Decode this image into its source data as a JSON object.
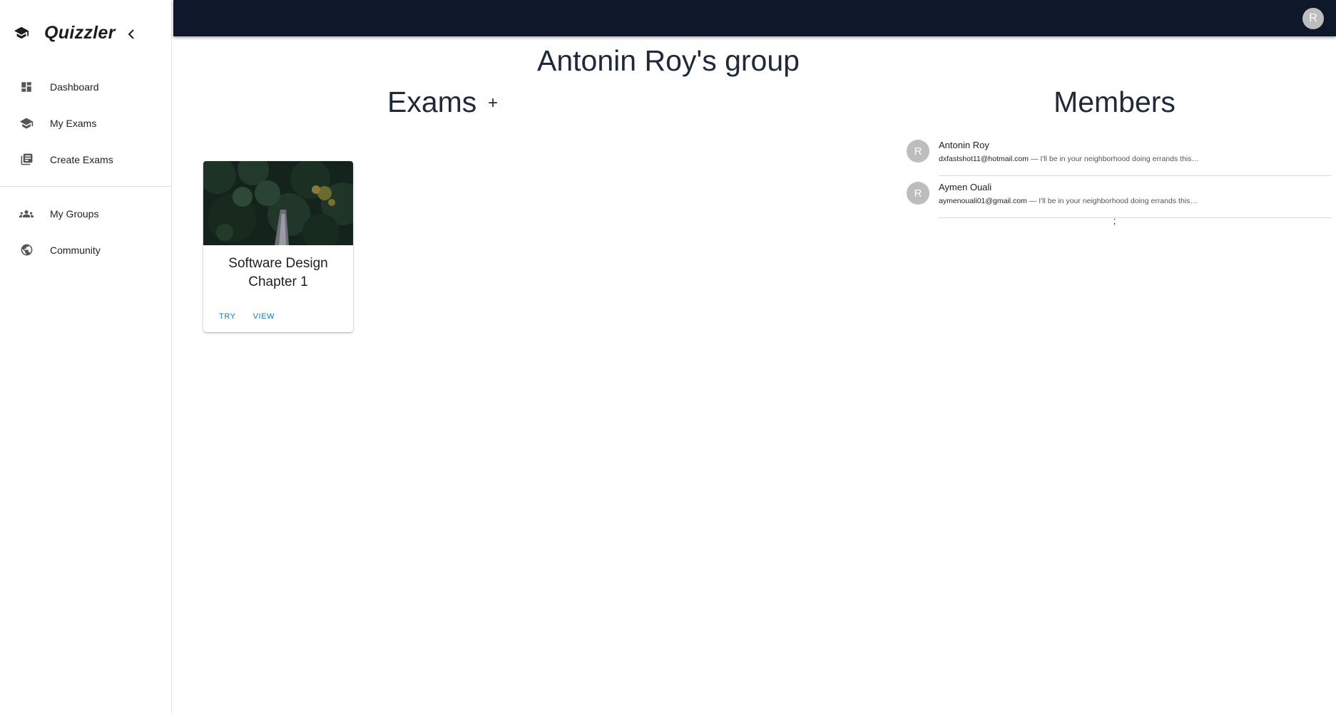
{
  "app": {
    "name": "Quizzler",
    "user_initial": "R"
  },
  "sidebar": {
    "items": [
      {
        "label": "Dashboard",
        "icon": "dashboard-icon"
      },
      {
        "label": "My Exams",
        "icon": "graduation-cap-icon"
      },
      {
        "label": "Create Exams",
        "icon": "library-books-icon"
      },
      {
        "label": "My Groups",
        "icon": "groups-icon"
      },
      {
        "label": "Community",
        "icon": "globe-icon"
      }
    ]
  },
  "page": {
    "title": "Antonin Roy's group",
    "exams_heading": "Exams",
    "add_exam_symbol": "+",
    "members_heading": "Members"
  },
  "exams": [
    {
      "title_line1": "Software Design",
      "title_line2": "Chapter 1",
      "try_label": "TRY",
      "view_label": "VIEW"
    }
  ],
  "members": [
    {
      "initial": "R",
      "name": "Antonin Roy",
      "email": "dxfastshot11@hotmail.com",
      "preview": " — I'll be in your neighborhood doing errands this…"
    },
    {
      "initial": "R",
      "name": "Aymen Ouali",
      "email": "aymenouali01@gmail.com",
      "preview": " — I'll be in your neighborhood doing errands this…"
    }
  ],
  "members_footer": ";",
  "colors": {
    "topbar": "#0f172a",
    "heading": "#1e293b",
    "accent": "#1976d2",
    "avatar": "#bdbdbd"
  }
}
